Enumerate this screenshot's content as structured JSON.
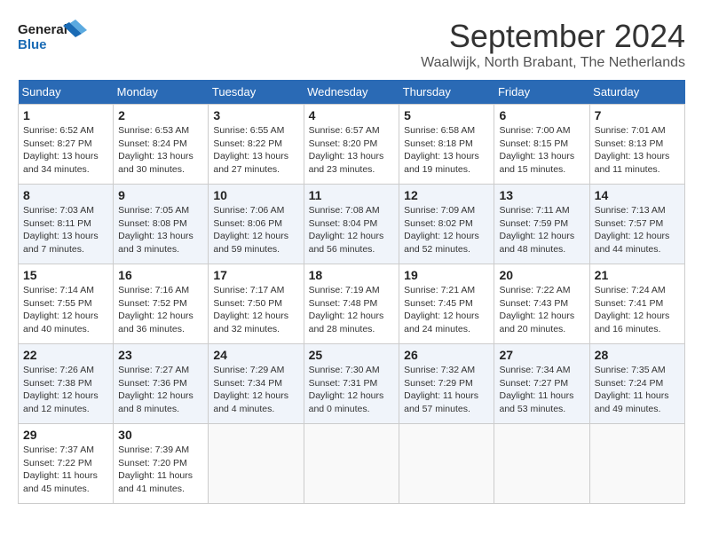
{
  "logo": {
    "line1": "General",
    "line2": "Blue"
  },
  "title": "September 2024",
  "subtitle": "Waalwijk, North Brabant, The Netherlands",
  "days_of_week": [
    "Sunday",
    "Monday",
    "Tuesday",
    "Wednesday",
    "Thursday",
    "Friday",
    "Saturday"
  ],
  "weeks": [
    [
      {
        "day": "1",
        "info": "Sunrise: 6:52 AM\nSunset: 8:27 PM\nDaylight: 13 hours\nand 34 minutes."
      },
      {
        "day": "2",
        "info": "Sunrise: 6:53 AM\nSunset: 8:24 PM\nDaylight: 13 hours\nand 30 minutes."
      },
      {
        "day": "3",
        "info": "Sunrise: 6:55 AM\nSunset: 8:22 PM\nDaylight: 13 hours\nand 27 minutes."
      },
      {
        "day": "4",
        "info": "Sunrise: 6:57 AM\nSunset: 8:20 PM\nDaylight: 13 hours\nand 23 minutes."
      },
      {
        "day": "5",
        "info": "Sunrise: 6:58 AM\nSunset: 8:18 PM\nDaylight: 13 hours\nand 19 minutes."
      },
      {
        "day": "6",
        "info": "Sunrise: 7:00 AM\nSunset: 8:15 PM\nDaylight: 13 hours\nand 15 minutes."
      },
      {
        "day": "7",
        "info": "Sunrise: 7:01 AM\nSunset: 8:13 PM\nDaylight: 13 hours\nand 11 minutes."
      }
    ],
    [
      {
        "day": "8",
        "info": "Sunrise: 7:03 AM\nSunset: 8:11 PM\nDaylight: 13 hours\nand 7 minutes."
      },
      {
        "day": "9",
        "info": "Sunrise: 7:05 AM\nSunset: 8:08 PM\nDaylight: 13 hours\nand 3 minutes."
      },
      {
        "day": "10",
        "info": "Sunrise: 7:06 AM\nSunset: 8:06 PM\nDaylight: 12 hours\nand 59 minutes."
      },
      {
        "day": "11",
        "info": "Sunrise: 7:08 AM\nSunset: 8:04 PM\nDaylight: 12 hours\nand 56 minutes."
      },
      {
        "day": "12",
        "info": "Sunrise: 7:09 AM\nSunset: 8:02 PM\nDaylight: 12 hours\nand 52 minutes."
      },
      {
        "day": "13",
        "info": "Sunrise: 7:11 AM\nSunset: 7:59 PM\nDaylight: 12 hours\nand 48 minutes."
      },
      {
        "day": "14",
        "info": "Sunrise: 7:13 AM\nSunset: 7:57 PM\nDaylight: 12 hours\nand 44 minutes."
      }
    ],
    [
      {
        "day": "15",
        "info": "Sunrise: 7:14 AM\nSunset: 7:55 PM\nDaylight: 12 hours\nand 40 minutes."
      },
      {
        "day": "16",
        "info": "Sunrise: 7:16 AM\nSunset: 7:52 PM\nDaylight: 12 hours\nand 36 minutes."
      },
      {
        "day": "17",
        "info": "Sunrise: 7:17 AM\nSunset: 7:50 PM\nDaylight: 12 hours\nand 32 minutes."
      },
      {
        "day": "18",
        "info": "Sunrise: 7:19 AM\nSunset: 7:48 PM\nDaylight: 12 hours\nand 28 minutes."
      },
      {
        "day": "19",
        "info": "Sunrise: 7:21 AM\nSunset: 7:45 PM\nDaylight: 12 hours\nand 24 minutes."
      },
      {
        "day": "20",
        "info": "Sunrise: 7:22 AM\nSunset: 7:43 PM\nDaylight: 12 hours\nand 20 minutes."
      },
      {
        "day": "21",
        "info": "Sunrise: 7:24 AM\nSunset: 7:41 PM\nDaylight: 12 hours\nand 16 minutes."
      }
    ],
    [
      {
        "day": "22",
        "info": "Sunrise: 7:26 AM\nSunset: 7:38 PM\nDaylight: 12 hours\nand 12 minutes."
      },
      {
        "day": "23",
        "info": "Sunrise: 7:27 AM\nSunset: 7:36 PM\nDaylight: 12 hours\nand 8 minutes."
      },
      {
        "day": "24",
        "info": "Sunrise: 7:29 AM\nSunset: 7:34 PM\nDaylight: 12 hours\nand 4 minutes."
      },
      {
        "day": "25",
        "info": "Sunrise: 7:30 AM\nSunset: 7:31 PM\nDaylight: 12 hours\nand 0 minutes."
      },
      {
        "day": "26",
        "info": "Sunrise: 7:32 AM\nSunset: 7:29 PM\nDaylight: 11 hours\nand 57 minutes."
      },
      {
        "day": "27",
        "info": "Sunrise: 7:34 AM\nSunset: 7:27 PM\nDaylight: 11 hours\nand 53 minutes."
      },
      {
        "day": "28",
        "info": "Sunrise: 7:35 AM\nSunset: 7:24 PM\nDaylight: 11 hours\nand 49 minutes."
      }
    ],
    [
      {
        "day": "29",
        "info": "Sunrise: 7:37 AM\nSunset: 7:22 PM\nDaylight: 11 hours\nand 45 minutes."
      },
      {
        "day": "30",
        "info": "Sunrise: 7:39 AM\nSunset: 7:20 PM\nDaylight: 11 hours\nand 41 minutes."
      },
      {
        "day": "",
        "info": ""
      },
      {
        "day": "",
        "info": ""
      },
      {
        "day": "",
        "info": ""
      },
      {
        "day": "",
        "info": ""
      },
      {
        "day": "",
        "info": ""
      }
    ]
  ]
}
